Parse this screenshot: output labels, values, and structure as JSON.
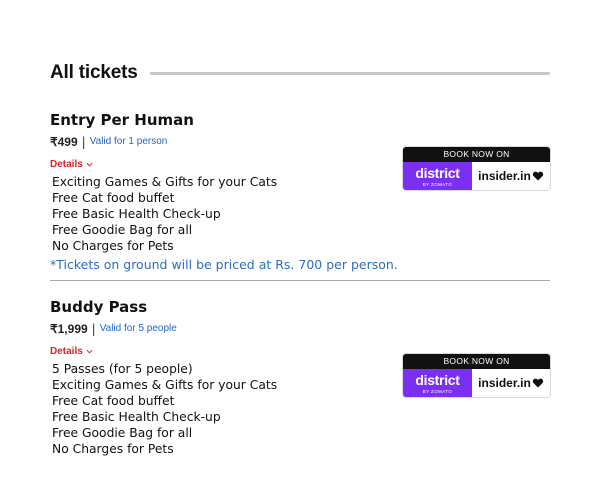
{
  "section": {
    "title": "All tickets"
  },
  "tickets": [
    {
      "name": "Entry Per Human",
      "price": "₹499",
      "separator": "|",
      "validity": "Valid for 1 person",
      "details_label": "Details",
      "features": [
        "Exciting Games & Gifts for your Cats",
        "Free Cat food buffet",
        "Free Basic Health Check-up",
        "Free Goodie Bag for all",
        "No Charges for Pets"
      ],
      "booking": {
        "label": "BOOK NOW ON",
        "partner1": "district",
        "partner1_sub": "BY ZOMATO",
        "partner2": "insider.in"
      }
    },
    {
      "name": "Buddy Pass",
      "price": "₹1,999",
      "separator": "|",
      "validity": "Valid for 5 people",
      "details_label": "Details",
      "features": [
        "5 Passes (for 5 people)",
        "Exciting Games & Gifts for your Cats",
        "Free Cat food buffet",
        "Free Basic Health Check-up",
        "Free Goodie Bag for all",
        "No Charges for Pets"
      ],
      "booking": {
        "label": "BOOK NOW ON",
        "partner1": "district",
        "partner1_sub": "BY ZOMATO",
        "partner2": "insider.in"
      }
    }
  ],
  "footnote": "*Tickets on ground will be priced at Rs. 700 per person.",
  "colors": {
    "accent_red": "#d4232a",
    "link_blue": "#2266c8",
    "district_purple": "#7b2ff2"
  },
  "icons": {
    "details_toggle": "chevron-down-icon",
    "insider_mark": "heart-icon"
  }
}
